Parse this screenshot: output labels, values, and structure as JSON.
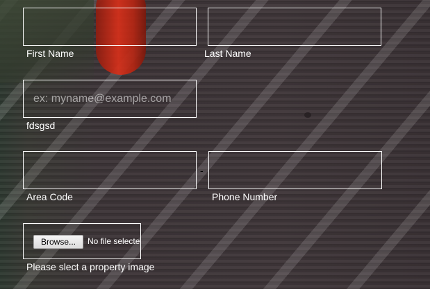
{
  "form": {
    "first_name": {
      "value": "",
      "label": "First Name"
    },
    "last_name": {
      "value": "",
      "label": "Last Name"
    },
    "email": {
      "value": "",
      "placeholder": "ex: myname@example.com",
      "label": "fdsgsd"
    },
    "area_code": {
      "value": "",
      "label": "Area Code"
    },
    "separator": "-",
    "phone_number": {
      "value": "",
      "label": "Phone Number"
    },
    "property_image": {
      "button_label": "Browse...",
      "status": "No file selected.",
      "label": "Please slect a property image"
    }
  },
  "colors": {
    "border": "#ffffff",
    "text": "#ffffff",
    "background": "#3d3538"
  }
}
